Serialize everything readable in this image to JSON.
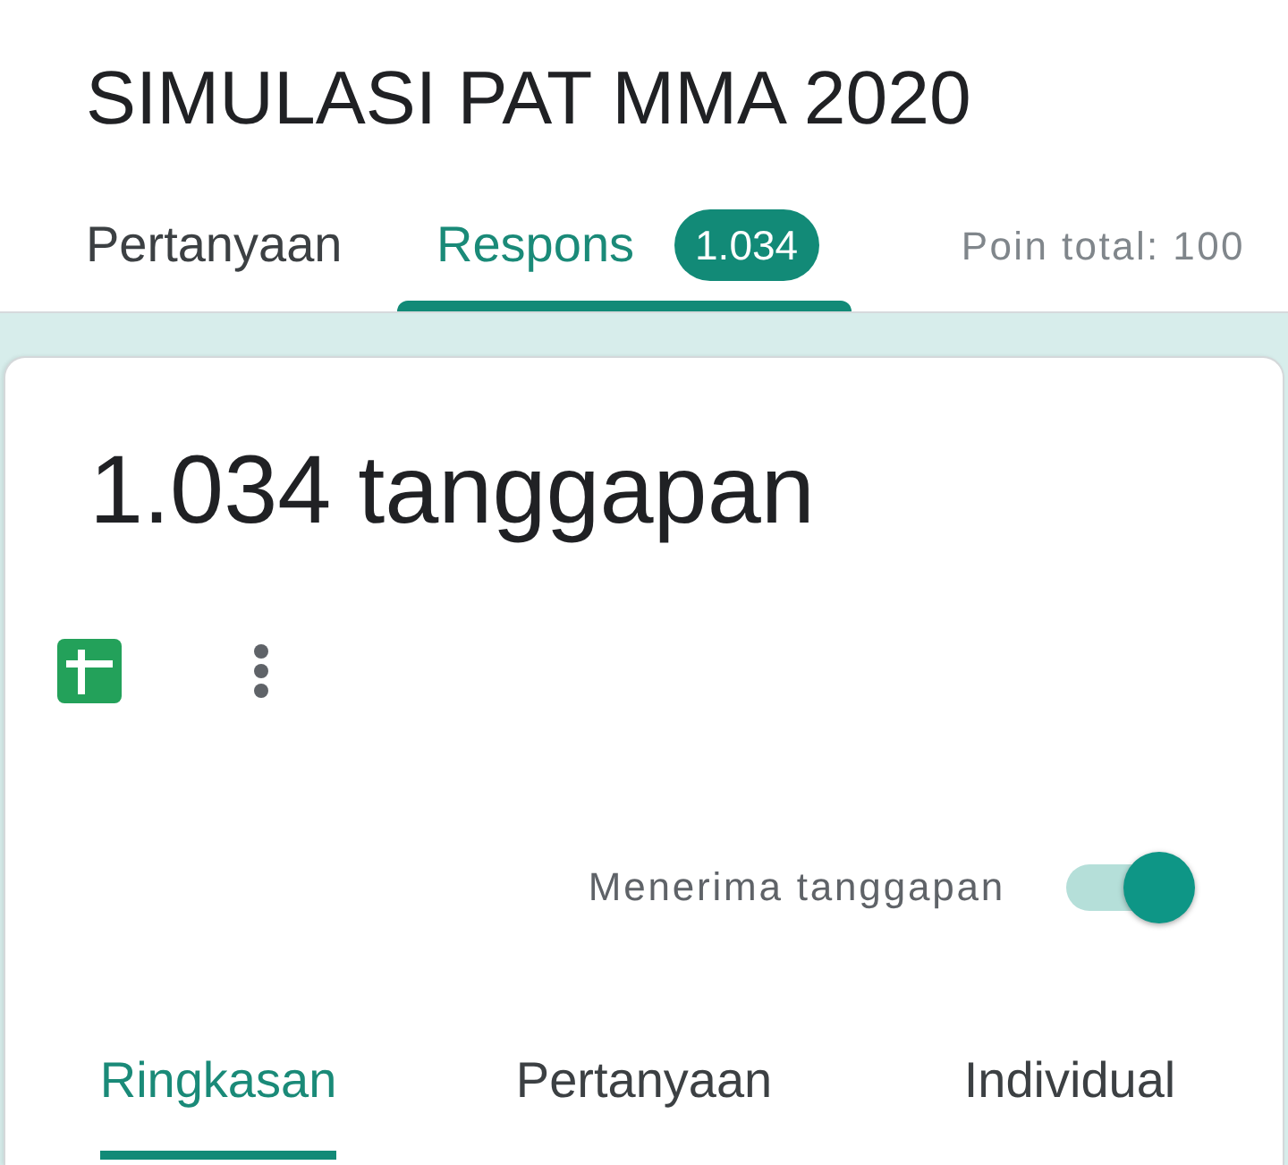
{
  "form": {
    "title": "SIMULASI PAT MMA 2020"
  },
  "tabs": [
    {
      "label": "Pertanyaan",
      "selected": false
    },
    {
      "label": "Respons",
      "selected": true,
      "badge": "1.034"
    }
  ],
  "points_total": "Poin total: 100",
  "responses": {
    "count_label": "1.034 tanggapan",
    "accepting": {
      "label": "Menerima tanggapan",
      "on": true
    }
  },
  "sub_tabs": [
    {
      "label": "Ringkasan",
      "selected": true
    },
    {
      "label": "Pertanyaan",
      "selected": false
    },
    {
      "label": "Individual",
      "selected": false
    }
  ]
}
